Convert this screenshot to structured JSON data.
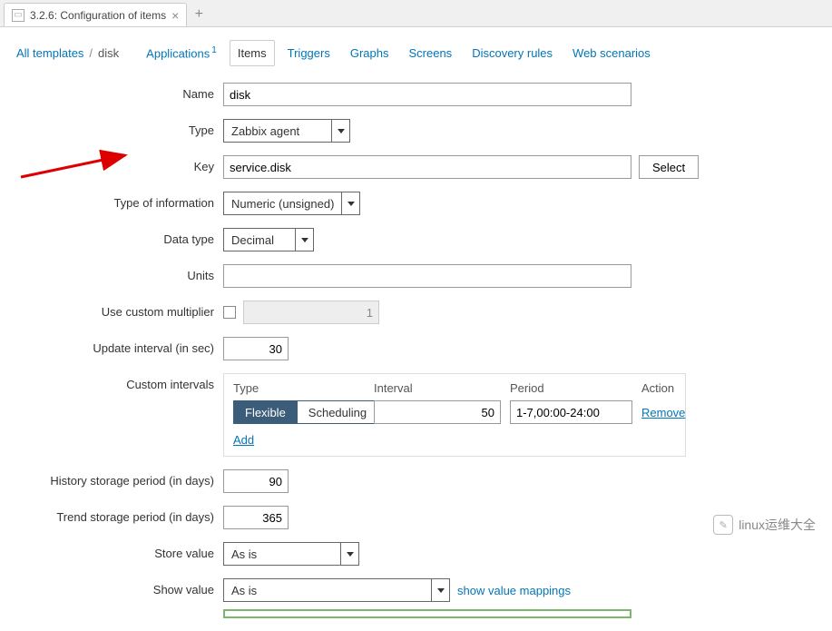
{
  "browser": {
    "tab_title": "3.2.6: Configuration of items"
  },
  "breadcrumb": {
    "all_templates": "All templates",
    "current": "disk"
  },
  "nav": {
    "applications": "Applications",
    "applications_count": "1",
    "items": "Items",
    "triggers": "Triggers",
    "graphs": "Graphs",
    "screens": "Screens",
    "discovery": "Discovery rules",
    "web": "Web scenarios"
  },
  "form": {
    "name_label": "Name",
    "name_value": "disk",
    "type_label": "Type",
    "type_value": "Zabbix agent",
    "key_label": "Key",
    "key_value": "service.disk",
    "select_btn": "Select",
    "info_type_label": "Type of information",
    "info_type_value": "Numeric (unsigned)",
    "data_type_label": "Data type",
    "data_type_value": "Decimal",
    "units_label": "Units",
    "units_value": "",
    "multiplier_label": "Use custom multiplier",
    "multiplier_value": "1",
    "update_label": "Update interval (in sec)",
    "update_value": "30",
    "custom_intervals_label": "Custom intervals",
    "history_label": "History storage period (in days)",
    "history_value": "90",
    "trend_label": "Trend storage period (in days)",
    "trend_value": "365",
    "store_label": "Store value",
    "store_value": "As is",
    "show_label": "Show value",
    "show_value": "As is",
    "show_mappings": "show value mappings"
  },
  "intervals": {
    "hdr_type": "Type",
    "hdr_interval": "Interval",
    "hdr_period": "Period",
    "hdr_action": "Action",
    "flexible": "Flexible",
    "scheduling": "Scheduling",
    "interval_value": "50",
    "period_value": "1-7,00:00-24:00",
    "remove": "Remove",
    "add": "Add"
  },
  "watermark": {
    "text": "linux运维大全"
  }
}
